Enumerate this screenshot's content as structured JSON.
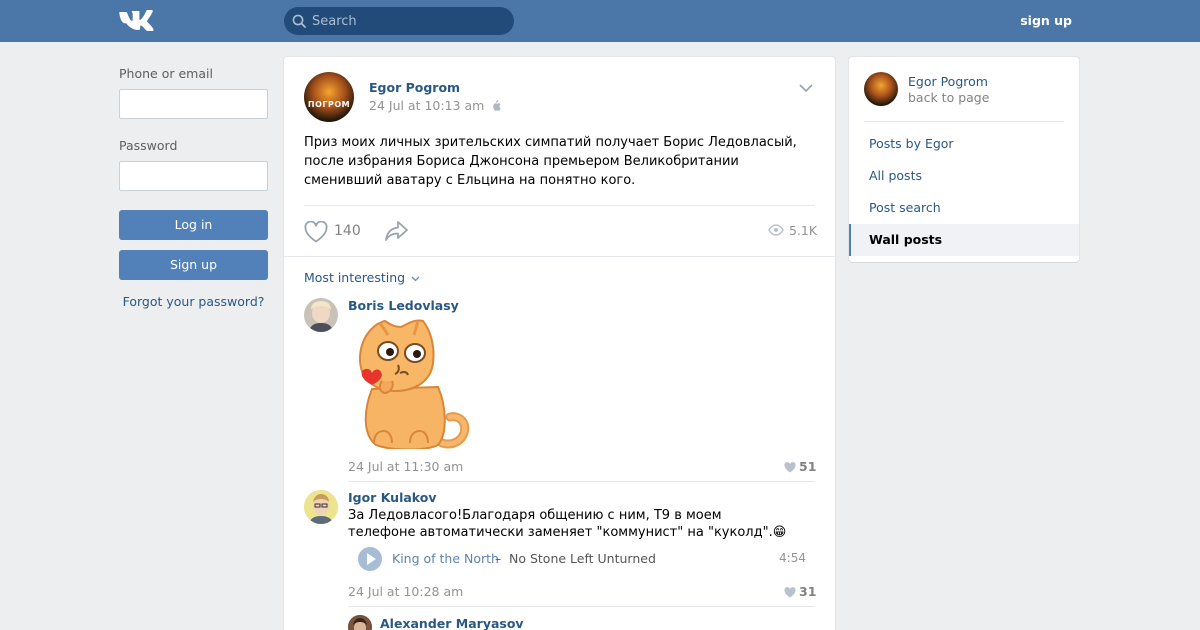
{
  "header": {
    "logo": "vk-logo-icon",
    "search_placeholder": "Search",
    "signup_label": "sign up"
  },
  "login": {
    "phone_label": "Phone or email",
    "phone_value": "",
    "password_label": "Password",
    "password_value": "",
    "login_button": "Log in",
    "signup_button": "Sign up",
    "forgot_link": "Forgot your password?"
  },
  "post": {
    "author": "Egor Pogrom",
    "avatar_text": "ПОГРОМ",
    "date": "24 Jul at 10:13 am",
    "text": "Приз моих личных зрительских симпатий получает Борис Ледовласый, после избрания Бориса Джонсона премьером Великобритании сменивший аватару с Ельцина на понятно кого.",
    "likes": "140",
    "views": "5.1K"
  },
  "comments": {
    "sort_label": "Most interesting",
    "items": [
      {
        "author": "Boris Ledovlasy",
        "date": "24 Jul at 11:30 am",
        "likes": "51"
      },
      {
        "author": "Igor Kulakov",
        "text": "За Ледовласого!Благодаря общению с ним, Т9 в моем телефоне автоматически заменяет \"коммунист\" на \"куколд\".",
        "emoji": "😁",
        "audio": {
          "artist": "King of the North",
          "dash": "–",
          "title": "No Stone Left Unturned",
          "duration": "4:54"
        },
        "date": "24 Jul at 10:28 am",
        "likes": "31"
      },
      {
        "author": "Alexander Maryasov"
      }
    ]
  },
  "sidebar": {
    "author": "Egor Pogrom",
    "back": "back to page",
    "items": [
      {
        "label": "Posts by Egor"
      },
      {
        "label": "All posts"
      },
      {
        "label": "Post search"
      },
      {
        "label": "Wall posts",
        "active": true
      }
    ]
  },
  "colors": {
    "header": "#4a76a8",
    "link": "#2a5885",
    "button": "#5181b8",
    "background": "#edeef0"
  }
}
